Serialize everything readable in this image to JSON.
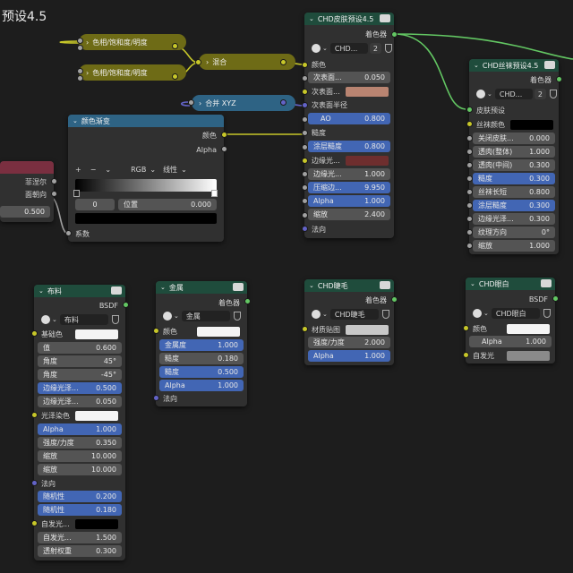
{
  "page_title": "预设4.5",
  "colors": {
    "canvas": "#1d1d1d",
    "node_body": "#303030",
    "shader_header": "#1f4c3c",
    "converter_header": "#2e6384",
    "group_header": "#6e6b16",
    "field_blue": "#4266b4"
  },
  "reroutes": {
    "hsv1": "色相/饱和度/明度",
    "hsv2": "色相/饱和度/明度",
    "mix": "混合",
    "combine": "合并 XYZ"
  },
  "fresnel_node": {
    "fresnel": "菲涅尔",
    "facing": "面朝向",
    "value": "0.500"
  },
  "color_ramp": {
    "title": "颜色渐变",
    "out_color": "颜色",
    "out_alpha": "Alpha",
    "mode": "RGB",
    "interp": "线性",
    "stop_index": "0",
    "pos_label": "位置",
    "pos_value": "0.000",
    "factor": "系数",
    "buttons": {
      "add": "+",
      "remove": "−",
      "menu": "⌄"
    }
  },
  "skin_node": {
    "title": "CHD皮肤预设4.5",
    "out": "着色器",
    "preset_name": "CHD...",
    "users": "2",
    "rows": [
      {
        "label": "颜色"
      },
      {
        "label": "次表面...",
        "value": "0.050"
      },
      {
        "label": "次表面..."
      },
      {
        "label": "次表面半径"
      },
      {
        "label": "AO",
        "value": "0.800"
      },
      {
        "label": "糙度"
      },
      {
        "label": "涂层糙度",
        "value": "0.800"
      },
      {
        "label": "边缘光..."
      },
      {
        "label": "边缘光...",
        "value": "1.000"
      },
      {
        "label": "压缩边...",
        "value": "9.950"
      },
      {
        "label": "Alpha",
        "value": "1.000"
      },
      {
        "label": "缩放",
        "value": "2.400"
      },
      {
        "label": "法向"
      }
    ],
    "swatch_subsurface": "#b98471",
    "swatch_rim": "#6e2e2e"
  },
  "silk_node": {
    "title": "CHD丝袜预设4.5",
    "out": "着色器",
    "preset_name": "CHD...",
    "users": "2",
    "rows": [
      {
        "label": "皮肤预设"
      },
      {
        "label": "丝袜颜色"
      },
      {
        "label": "关闭皮肤...",
        "value": "0.000"
      },
      {
        "label": "透肉(整体)",
        "value": "1.000"
      },
      {
        "label": "透肉(中间)",
        "value": "0.300"
      },
      {
        "label": "糙度",
        "value": "0.300"
      },
      {
        "label": "丝袜长短",
        "value": "0.800"
      },
      {
        "label": "涂层糙度",
        "value": "0.300"
      },
      {
        "label": "边缘光泽...",
        "value": "0.300"
      },
      {
        "label": "纹理方向",
        "value": "0°"
      },
      {
        "label": "缩放",
        "value": "1.000"
      }
    ]
  },
  "cloth_node": {
    "title": "布料",
    "out": "BSDF",
    "preset_name": "布料",
    "rows": [
      {
        "label": "基础色"
      },
      {
        "label": "值",
        "value": "0.600"
      },
      {
        "label": "角度",
        "value": "45°"
      },
      {
        "label": "角度",
        "value": "-45°"
      },
      {
        "label": "边缘光泽...",
        "value": "0.500"
      },
      {
        "label": "边缘光泽...",
        "value": "0.050"
      },
      {
        "label": "光泽染色"
      },
      {
        "label": "Alpha",
        "value": "1.000"
      },
      {
        "label": "强度/力度",
        "value": "0.350"
      },
      {
        "label": "缩放",
        "value": "10.000"
      },
      {
        "label": "缩放",
        "value": "10.000"
      },
      {
        "label": "法向"
      },
      {
        "label": "随机性",
        "value": "0.200"
      },
      {
        "label": "随机性",
        "value": "0.180"
      },
      {
        "label": "自发光..."
      },
      {
        "label": "自发光...",
        "value": "1.500"
      },
      {
        "label": "透射权重",
        "value": "0.300"
      }
    ]
  },
  "metal_node": {
    "title": "金属",
    "out": "着色器",
    "preset_name": "金属",
    "rows": [
      {
        "label": "颜色"
      },
      {
        "label": "金属度",
        "value": "1.000"
      },
      {
        "label": "糙度",
        "value": "0.180"
      },
      {
        "label": "糙度",
        "value": "0.500"
      },
      {
        "label": "Alpha",
        "value": "1.000"
      },
      {
        "label": "法向"
      }
    ]
  },
  "eyelash_node": {
    "title": "CHD睫毛",
    "out": "着色器",
    "preset_name": "CHD睫毛",
    "rows": [
      {
        "label": "材质贴图"
      },
      {
        "label": "强度/力度",
        "value": "2.000"
      },
      {
        "label": "Alpha",
        "value": "1.000"
      }
    ]
  },
  "eyewhite_node": {
    "title": "CHD眼白",
    "out": "BSDF",
    "preset_name": "CHD眼白",
    "rows": [
      {
        "label": "颜色"
      },
      {
        "label": "Alpha",
        "value": "1.000"
      },
      {
        "label": "自发光"
      }
    ]
  }
}
